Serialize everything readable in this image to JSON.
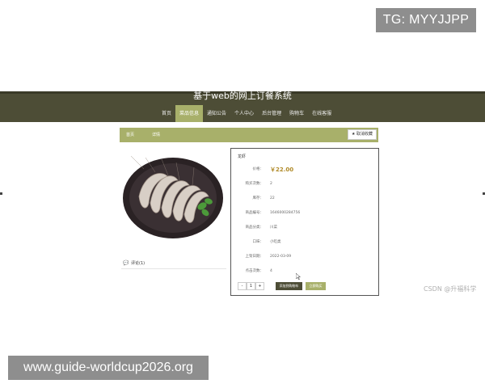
{
  "watermarks": {
    "top": "TG: MYYJJPP",
    "bottom": "www.guide-worldcup2026.org",
    "csdn": "CSDN @升福科学"
  },
  "site": {
    "title": "基于web的网上订餐系统",
    "nav": [
      "首页",
      "菜品信息",
      "通知公告",
      "个人中心",
      "后台管理",
      "购物车",
      "在线客服"
    ],
    "active_nav_index": 1
  },
  "breadcrumb": {
    "items": [
      "首页",
      "详情"
    ],
    "favorite_label": "★ 取消收藏"
  },
  "product": {
    "name": "龙虾",
    "image_icon": "shrimp-plate-image",
    "fields": [
      {
        "label": "价格：",
        "value": "￥22.00"
      },
      {
        "label": "购买次数：",
        "value": "2"
      },
      {
        "label": "库存：",
        "value": "22"
      },
      {
        "label": "商品编号：",
        "value": "1646000284756"
      },
      {
        "label": "商品分类：",
        "value": "川菜"
      },
      {
        "label": "口味：",
        "value": "小吃类"
      },
      {
        "label": "上架日期：",
        "value": "2022-03-09"
      },
      {
        "label": "点击次数：",
        "value": "4"
      }
    ],
    "quantity": {
      "minus": "-",
      "value": "1",
      "plus": "+"
    },
    "add_to_cart_label": "添加到购物车",
    "buy_now_label": "立即购买"
  },
  "reviews": {
    "label": "评论(1)",
    "icon": "comment-icon"
  },
  "colors": {
    "header_bg": "#4d4d36",
    "accent": "#a8b06a",
    "price": "#b08a28"
  }
}
